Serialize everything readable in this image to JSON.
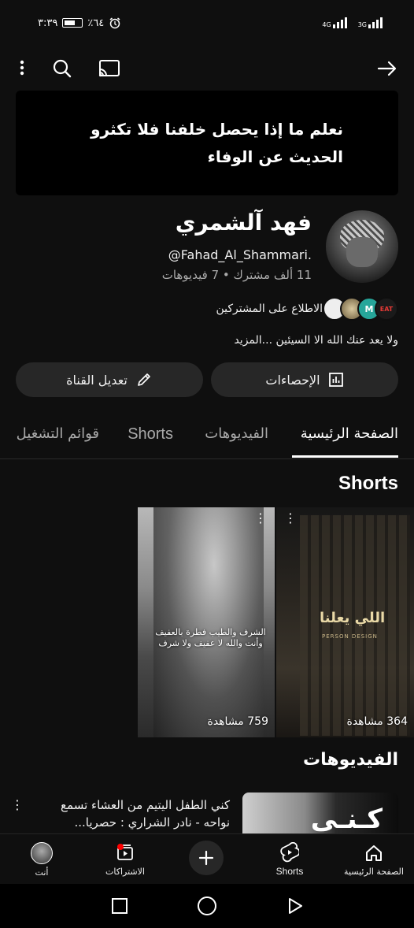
{
  "status_bar": {
    "time": "٣:٣٩",
    "battery": "٪٦٤",
    "network_1": "4G",
    "network_2": "3G"
  },
  "top_bar": {
    "icons": [
      "more-vert-icon",
      "search-icon",
      "cast-icon",
      "forward-arrow-icon"
    ]
  },
  "banner": {
    "line1": "نعلم ما إذا يحصل خلفنا فلا تكثرو",
    "line2": "الحديث عن الوفاء"
  },
  "channel": {
    "name": "فهد آلشمري",
    "handle": "@Fahad_Al_Shammari.",
    "stats": "11 ألف مشترك • 7 فيديوهات",
    "subscribers_label": "الاطلاع على المشتركين",
    "subscriber_avatars": [
      "EAT",
      "M",
      "",
      ""
    ],
    "description": "ولا يعد عنك الله الا السيئين ...المزيد"
  },
  "buttons": {
    "stats_label": "الإحصاءات",
    "edit_label": "تعديل القناة"
  },
  "tabs": [
    {
      "label": "الصفحة الرئيسية",
      "active": true
    },
    {
      "label": "الفيديوهات",
      "active": false
    },
    {
      "label": "Shorts",
      "active": false
    },
    {
      "label": "قوائم التشغيل",
      "active": false
    }
  ],
  "shorts_section": {
    "title": "Shorts",
    "items": [
      {
        "views": "364 مشاهدة",
        "overlay_title": "اللي يعلنا",
        "overlay_sub": "PERSON DESIGN"
      },
      {
        "views": "759 مشاهدة",
        "caption": "الشرف والطيب فطرة بالعفيف وأنت والله لا عفيف ولا شرف"
      }
    ]
  },
  "videos_section": {
    "title": "الفيديوهات",
    "items": [
      {
        "title": "كني الطفل اليتيم من العشاء تسمع نواحه - نادر الشراري : حصريا...",
        "thumb_text": "كـنـى"
      }
    ]
  },
  "bottom_nav": {
    "home": "الصفحة الرئيسية",
    "shorts": "Shorts",
    "subscriptions": "الاشتراكات",
    "you": "أنت"
  },
  "colors": {
    "background": "#0f0f0f",
    "surface": "#272727",
    "text": "#f1f1f1",
    "muted": "#aaaaaa",
    "notification": "#ff0000"
  }
}
